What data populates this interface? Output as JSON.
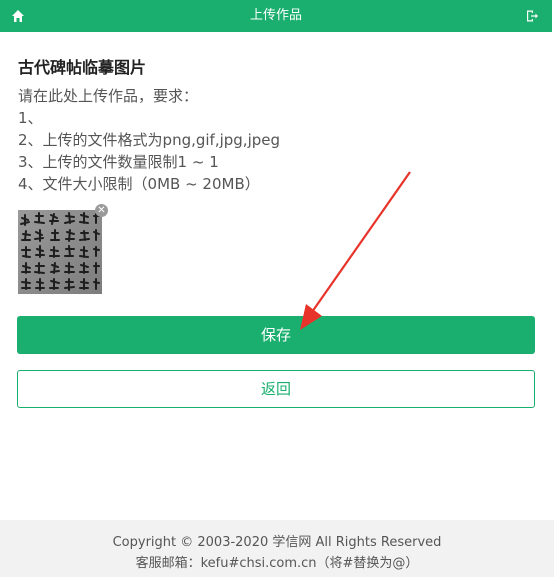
{
  "header": {
    "title": "上传作品",
    "home_icon": "home-icon",
    "logout_icon": "logout-icon",
    "bg_color": "#1aaf6e"
  },
  "main": {
    "heading": "古代碑帖临摹图片",
    "requirements": [
      "请在此处上传作品，要求：",
      "1、",
      "2、上传的文件格式为png,gif,jpg,jpeg",
      "3、上传的文件数量限制1 ~ 1",
      "4、文件大小限制（0MB ~ 20MB）"
    ]
  },
  "buttons": {
    "save": "保存",
    "back": "返回"
  },
  "footer": {
    "copyright": "Copyright © 2003-2020 学信网 All Rights Reserved",
    "contact": "客服邮箱：kefu#chsi.com.cn（将#替换为@）"
  }
}
